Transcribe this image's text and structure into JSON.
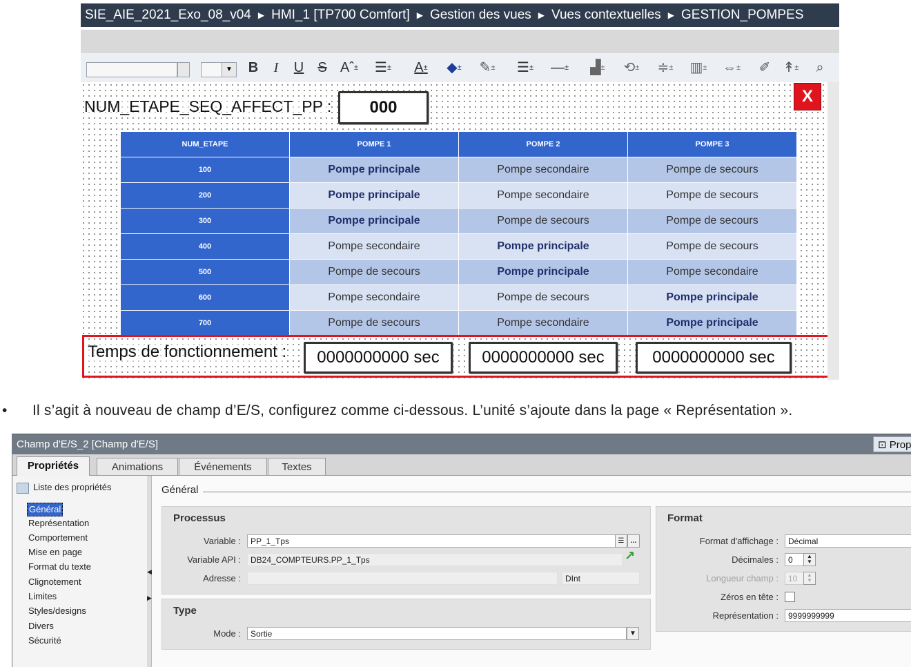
{
  "breadcrumb": [
    "SIE_AIE_2021_Exo_08_v04",
    "HMI_1 [TP700 Comfort]",
    "Gestion des vues",
    "Vues contextuelles",
    "GESTION_POMPES"
  ],
  "toolbar": {
    "bold": "B",
    "italic": "I",
    "underline": "U",
    "strike": "S"
  },
  "screen": {
    "num_label": "NUM_ETAPE_SEQ_AFFECT_PP :",
    "num_value": "000",
    "close_label": "X",
    "table": {
      "headers": [
        "NUM_ETAPE",
        "POMPE 1",
        "POMPE 2",
        "POMPE 3"
      ],
      "rows": [
        {
          "step": "100",
          "p1": "Pompe principale",
          "p2": "Pompe secondaire",
          "p3": "Pompe de secours"
        },
        {
          "step": "200",
          "p1": "Pompe principale",
          "p2": "Pompe secondaire",
          "p3": "Pompe de secours"
        },
        {
          "step": "300",
          "p1": "Pompe principale",
          "p2": "Pompe de secours",
          "p3": "Pompe de secours"
        },
        {
          "step": "400",
          "p1": "Pompe secondaire",
          "p2": "Pompe principale",
          "p3": "Pompe de secours"
        },
        {
          "step": "500",
          "p1": "Pompe de secours",
          "p2": "Pompe principale",
          "p3": "Pompe secondaire"
        },
        {
          "step": "600",
          "p1": "Pompe secondaire",
          "p2": "Pompe de secours",
          "p3": "Pompe principale"
        },
        {
          "step": "700",
          "p1": "Pompe de secours",
          "p2": "Pompe secondaire",
          "p3": "Pompe principale"
        }
      ]
    },
    "temps_label": "Temps de fonctionnement :",
    "temps_values": [
      "0000000000 sec",
      "0000000000 sec",
      "0000000000 sec"
    ]
  },
  "bullet": {
    "dot": "•",
    "text": "Il s’agit à nouveau de champ d’E/S, configurez comme ci-dessous. L’unité s’ajoute dans la page « Représentation »."
  },
  "props": {
    "title": "Champ d'E/S_2 [Champ d'E/S]",
    "prop_button": "Prop",
    "tabs": [
      "Propriétés",
      "Animations",
      "Événements",
      "Textes"
    ],
    "sidebar_head": "Liste des propriétés",
    "sidebar_items": [
      "Général",
      "Représentation",
      "Comportement",
      "Mise en page",
      "Format du texte",
      "Clignotement",
      "Limites",
      "Styles/designs",
      "Divers",
      "Sécurité"
    ],
    "section_title": "Général",
    "processus": {
      "title": "Processus",
      "variable_label": "Variable :",
      "variable_value": "PP_1_Tps",
      "variable_btn": "...",
      "api_label": "Variable API :",
      "api_value": "DB24_COMPTEURS.PP_1_Tps",
      "adresse_label": "Adresse :",
      "adresse_value": "",
      "type_value": "DInt"
    },
    "type": {
      "title": "Type",
      "mode_label": "Mode :",
      "mode_value": "Sortie"
    },
    "format": {
      "title": "Format",
      "affichage_label": "Format d'affichage :",
      "affichage_value": "Décimal",
      "decimales_label": "Décimales :",
      "decimales_value": "0",
      "longueur_label": "Longueur champ :",
      "longueur_value": "10",
      "zeros_label": "Zéros en tête :",
      "repr_label": "Représentation :",
      "repr_value": "9999999999"
    }
  }
}
